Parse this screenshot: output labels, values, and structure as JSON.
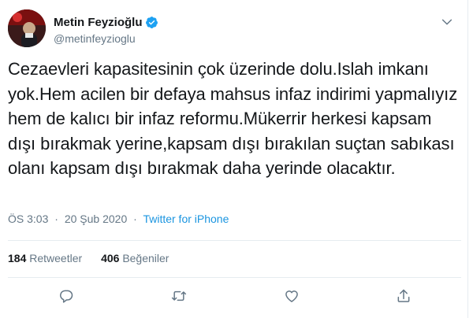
{
  "user": {
    "name": "Metin Feyzioğlu",
    "handle": "@metinfeyzioglu",
    "verified": true
  },
  "tweet": {
    "text": "Cezaevleri kapasitesinin çok üzerinde dolu.Islah imkanı yok.Hem acilen bir defaya mahsus infaz indirimi yapmalıyız hem de kalıcı bir infaz reformu.Mükerrir herkesi kapsam dışı bırakmak yerine,kapsam dışı bırakılan suçtan sabıkası olanı kapsam dışı bırakmak daha yerinde olacaktır."
  },
  "meta": {
    "time": "ÖS 3:03",
    "separator": "·",
    "date": "20 Şub 2020",
    "source": "Twitter for iPhone"
  },
  "stats": {
    "retweets_count": "184",
    "retweets_label": "Retweetler",
    "likes_count": "406",
    "likes_label": "Beğeniler"
  },
  "icons": {
    "verified": "verified-badge-icon",
    "caret": "chevron-down-icon",
    "reply": "reply-icon",
    "retweet": "retweet-icon",
    "like": "heart-icon",
    "share": "share-icon"
  },
  "colors": {
    "accent": "#1b95e0",
    "verified": "#1da1f2",
    "text": "#14171a",
    "secondary": "#657786",
    "divider": "#e6ecf0"
  }
}
